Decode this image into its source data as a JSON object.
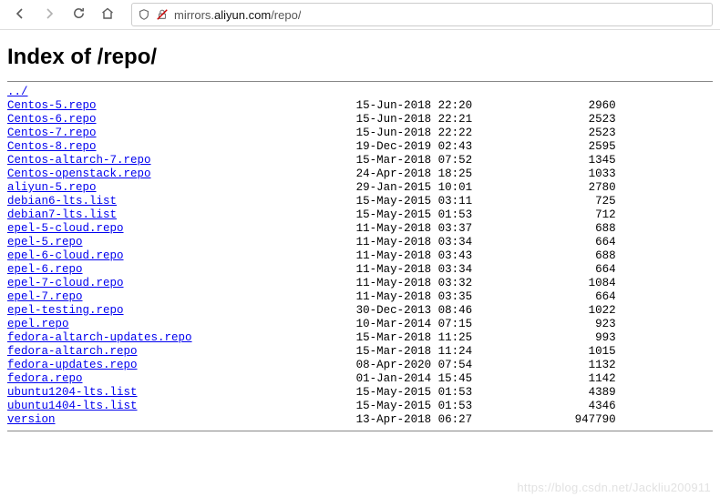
{
  "browser": {
    "url_prefix": "mirrors.",
    "url_domain": "aliyun.com",
    "url_path": "/repo/"
  },
  "page": {
    "title": "Index of /repo/",
    "parent_link": "../",
    "watermark": "https://blog.csdn.net/Jackliu200911"
  },
  "entries": [
    {
      "name": "Centos-5.repo",
      "date": "15-Jun-2018 22:20",
      "size": "2960"
    },
    {
      "name": "Centos-6.repo",
      "date": "15-Jun-2018 22:21",
      "size": "2523"
    },
    {
      "name": "Centos-7.repo",
      "date": "15-Jun-2018 22:22",
      "size": "2523"
    },
    {
      "name": "Centos-8.repo",
      "date": "19-Dec-2019 02:43",
      "size": "2595"
    },
    {
      "name": "Centos-altarch-7.repo",
      "date": "15-Mar-2018 07:52",
      "size": "1345"
    },
    {
      "name": "Centos-openstack.repo",
      "date": "24-Apr-2018 18:25",
      "size": "1033"
    },
    {
      "name": "aliyun-5.repo",
      "date": "29-Jan-2015 10:01",
      "size": "2780"
    },
    {
      "name": "debian6-lts.list",
      "date": "15-May-2015 03:11",
      "size": "725"
    },
    {
      "name": "debian7-lts.list",
      "date": "15-May-2015 01:53",
      "size": "712"
    },
    {
      "name": "epel-5-cloud.repo",
      "date": "11-May-2018 03:37",
      "size": "688"
    },
    {
      "name": "epel-5.repo",
      "date": "11-May-2018 03:34",
      "size": "664"
    },
    {
      "name": "epel-6-cloud.repo",
      "date": "11-May-2018 03:43",
      "size": "688"
    },
    {
      "name": "epel-6.repo",
      "date": "11-May-2018 03:34",
      "size": "664"
    },
    {
      "name": "epel-7-cloud.repo",
      "date": "11-May-2018 03:32",
      "size": "1084"
    },
    {
      "name": "epel-7.repo",
      "date": "11-May-2018 03:35",
      "size": "664"
    },
    {
      "name": "epel-testing.repo",
      "date": "30-Dec-2013 08:46",
      "size": "1022"
    },
    {
      "name": "epel.repo",
      "date": "10-Mar-2014 07:15",
      "size": "923"
    },
    {
      "name": "fedora-altarch-updates.repo",
      "date": "15-Mar-2018 11:25",
      "size": "993"
    },
    {
      "name": "fedora-altarch.repo",
      "date": "15-Mar-2018 11:24",
      "size": "1015"
    },
    {
      "name": "fedora-updates.repo",
      "date": "08-Apr-2020 07:54",
      "size": "1132"
    },
    {
      "name": "fedora.repo",
      "date": "01-Jan-2014 15:45",
      "size": "1142"
    },
    {
      "name": "ubuntu1204-lts.list",
      "date": "15-May-2015 01:53",
      "size": "4389"
    },
    {
      "name": "ubuntu1404-lts.list",
      "date": "15-May-2015 01:53",
      "size": "4346"
    },
    {
      "name": "version",
      "date": "13-Apr-2018 06:27",
      "size": "947790"
    }
  ]
}
